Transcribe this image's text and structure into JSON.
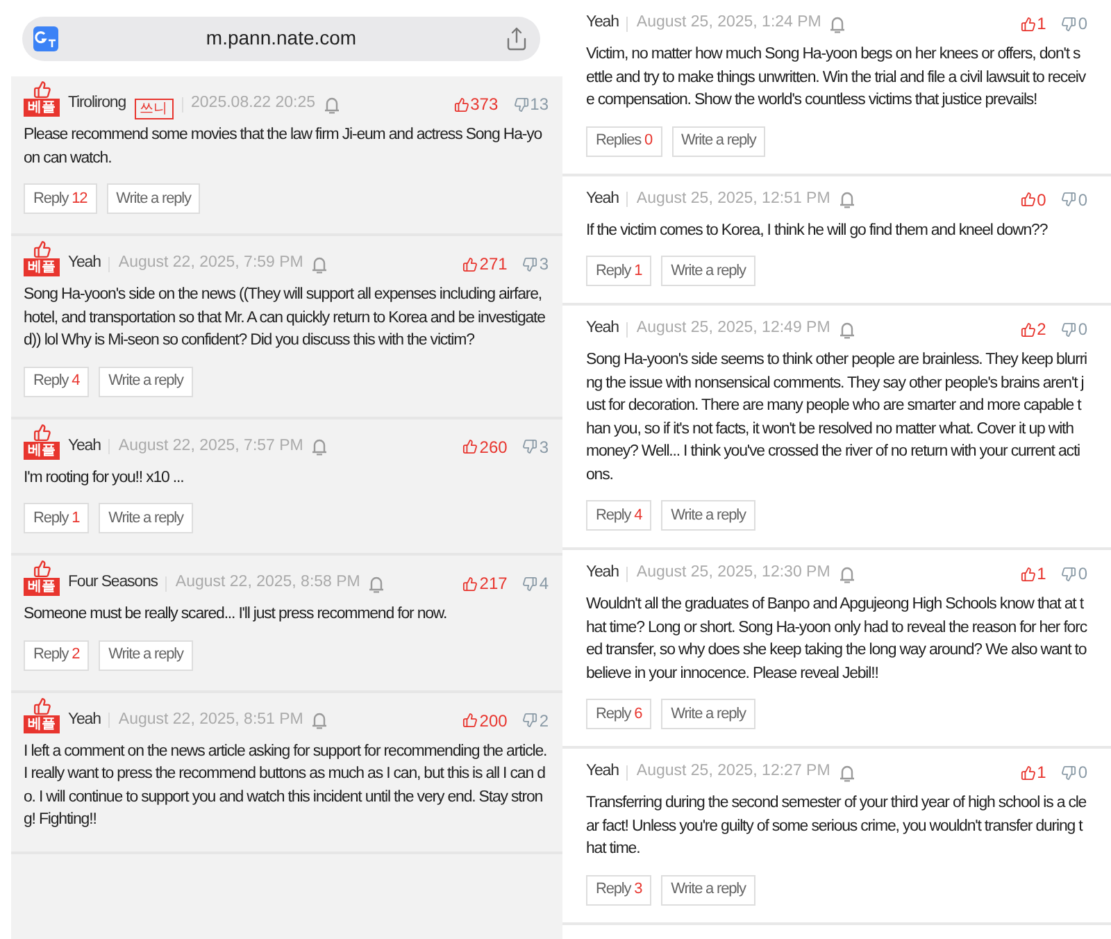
{
  "left_panel": {
    "address_bar": {
      "url": "m.pann.nate.com"
    },
    "comments": [
      {
        "best_badge": "베플",
        "author": "Tirolirong",
        "author_badge": "쓰니",
        "date": "2025.08.22 20:25",
        "likes": "373",
        "dislikes": "13",
        "text": "Please recommend some movies that the law firm Ji-eum and actress Song Ha-yoon can watch.",
        "reply_label": "Reply",
        "reply_count": "12",
        "write_reply": "Write a reply"
      },
      {
        "best_badge": "베플",
        "author": "Yeah",
        "date": "August 22, 2025, 7:59 PM",
        "likes": "271",
        "dislikes": "3",
        "text": "Song Ha-yoon's side on the news ((They will support all expenses including airfare, hotel, and transportation so that Mr. A can quickly return to Korea and be investigated)) lol Why is Mi-seon so confident? Did you discuss this with the victim?",
        "reply_label": "Reply",
        "reply_count": "4",
        "write_reply": "Write a reply"
      },
      {
        "best_badge": "베플",
        "author": "Yeah",
        "date": "August 22, 2025, 7:57 PM",
        "likes": "260",
        "dislikes": "3",
        "text": "I'm rooting for you!! x10 ...",
        "reply_label": "Reply",
        "reply_count": "1",
        "write_reply": "Write a reply"
      },
      {
        "best_badge": "베플",
        "author": "Four Seasons",
        "date": "August 22, 2025, 8:58 PM",
        "likes": "217",
        "dislikes": "4",
        "text": "Someone must be really scared... I'll just press recommend for now.",
        "reply_label": "Reply",
        "reply_count": "2",
        "write_reply": "Write a reply"
      },
      {
        "best_badge": "베플",
        "author": "Yeah",
        "date": "August 22, 2025, 8:51 PM",
        "likes": "200",
        "dislikes": "2",
        "text": "I left a comment on the news article asking for support for recommending the article. I really want to press the recommend buttons as much as I can, but this is all I can do. I will continue to support you and watch this incident until the very end. Stay strong! Fighting!!"
      }
    ]
  },
  "right_panel": {
    "comments": [
      {
        "author": "Yeah",
        "date": "August 25, 2025, 1:24 PM",
        "likes": "1",
        "dislikes": "0",
        "text": "Victim, no matter how much Song Ha-yoon begs on her knees or offers, don't settle and try to make things unwritten. Win the trial and file a civil lawsuit to receive compensation. Show the world's countless victims that justice prevails!",
        "reply_label": "Replies",
        "reply_count": "0",
        "write_reply": "Write a reply"
      },
      {
        "author": "Yeah",
        "date": "August 25, 2025, 12:51 PM",
        "likes": "0",
        "dislikes": "0",
        "text": "If the victim comes to Korea, I think he will go find them and kneel down??",
        "reply_label": "Reply",
        "reply_count": "1",
        "write_reply": "Write a reply"
      },
      {
        "author": "Yeah",
        "date": "August 25, 2025, 12:49 PM",
        "likes": "2",
        "dislikes": "0",
        "text": "Song Ha-yoon's side seems to think other people are brainless. They keep blurring the issue with nonsensical comments. They say other people's brains aren't just for decoration. There are many people who are smarter and more capable than you, so if it's not facts, it won't be resolved no matter what. Cover it up with money? Well... I think you've crossed the river of no return with your current actions.",
        "reply_label": "Reply",
        "reply_count": "4",
        "write_reply": "Write a reply"
      },
      {
        "author": "Yeah",
        "date": "August 25, 2025, 12:30 PM",
        "likes": "1",
        "dislikes": "0",
        "text": "Wouldn't all the graduates of Banpo and Apgujeong High Schools know that at that time? Long or short. Song Ha-yoon only had to reveal the reason for her forced transfer, so why does she keep taking the long way around? We also want to believe in your innocence. Please reveal Jebil!!",
        "reply_label": "Reply",
        "reply_count": "6",
        "write_reply": "Write a reply"
      },
      {
        "author": "Yeah",
        "date": "August 25, 2025, 12:27 PM",
        "likes": "1",
        "dislikes": "0",
        "text": "Transferring during the second semester of your third year of high school is a clear fact! Unless you're guilty of some serious crime, you wouldn't transfer during that time.",
        "reply_label": "Reply",
        "reply_count": "3",
        "write_reply": "Write a reply"
      }
    ]
  }
}
